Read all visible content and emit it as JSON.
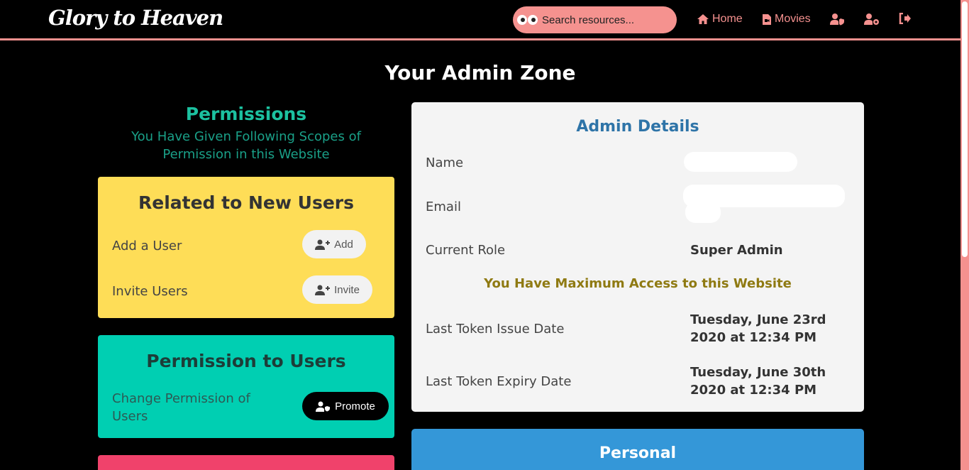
{
  "nav": {
    "brand": "Glory to Heaven",
    "search_placeholder": "Search resources...",
    "home_label": "Home",
    "movies_label": "Movies"
  },
  "page": {
    "title": "Your Admin Zone"
  },
  "permissions": {
    "title": "Permissions",
    "subtitle": "You Have Given Following Scopes of Permission in this Website",
    "new_users": {
      "title": "Related to New Users",
      "add_label": "Add a User",
      "add_button": "Add",
      "invite_label": "Invite Users",
      "invite_button": "Invite"
    },
    "to_users": {
      "title": "Permission to Users",
      "change_label": "Change Permission of Users",
      "promote_button": "Promote"
    }
  },
  "admin_details": {
    "title": "Admin Details",
    "name_label": "Name",
    "email_label": "Email",
    "role_label": "Current Role",
    "role_value": "Super Admin",
    "access_note": "You Have Maximum Access to this Website",
    "issue_label": "Last Token Issue Date",
    "issue_value_line1": "Tuesday, June 23rd",
    "issue_value_line2": "2020 at 12:34 PM",
    "expiry_label": "Last Token Expiry Date",
    "expiry_value_line1": "Tuesday, June 30th",
    "expiry_value_line2": "2020 at 12:34 PM"
  },
  "personal": {
    "title": "Personal"
  },
  "colors": {
    "accent": "#f5918f",
    "yellow_card": "#fedd57",
    "teal_card": "#00cfb2",
    "pink_card": "#f0426b",
    "blue_card": "#3497d8"
  }
}
